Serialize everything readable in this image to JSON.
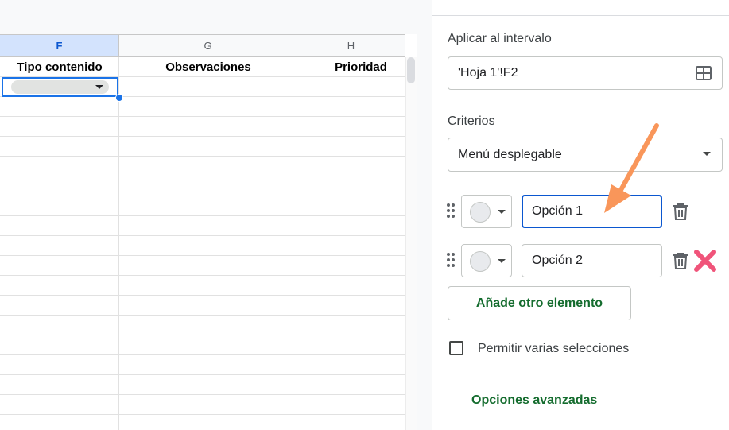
{
  "sheet": {
    "columns": [
      {
        "letter": "F",
        "header": "Tipo contenido",
        "selected": true
      },
      {
        "letter": "G",
        "header": "Observaciones",
        "selected": false
      },
      {
        "letter": "H",
        "header": "Prioridad",
        "selected": false
      }
    ],
    "active_cell": "F2"
  },
  "panel": {
    "range_label": "Aplicar al intervalo",
    "range_value": "'Hoja 1'!F2",
    "criteria_label": "Criterios",
    "criteria_value": "Menú desplegable",
    "options": [
      {
        "value": "Opción 1",
        "focused": true
      },
      {
        "value": "Opción 2",
        "focused": false
      }
    ],
    "add_item_label": "Añade otro elemento",
    "multi_select_label": "Permitir varias selecciones",
    "multi_select_checked": false,
    "advanced_options_label": "Opciones avanzadas"
  },
  "annotations": {
    "arrow_color": "#f9965a",
    "x_color": "#f0547a"
  },
  "colors": {
    "accent_blue": "#1a73e8",
    "accent_green": "#146c2e",
    "selected_column_header": "#d3e3fd"
  }
}
